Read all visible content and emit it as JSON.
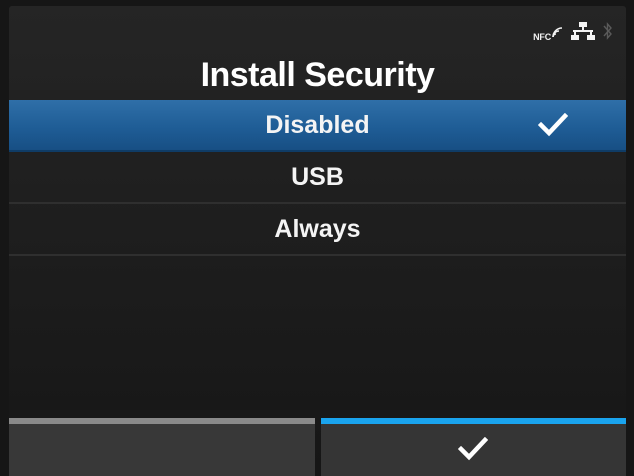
{
  "status_bar": {
    "nfc_label": "NFC",
    "icons": [
      "nfc-icon",
      "network-icon",
      "bluetooth-icon"
    ]
  },
  "screen": {
    "title": "Install Security"
  },
  "options": [
    {
      "label": "Disabled",
      "selected": true
    },
    {
      "label": "USB",
      "selected": false
    },
    {
      "label": "Always",
      "selected": false
    }
  ],
  "softkeys": {
    "left": {
      "icon": "",
      "highlight": "#8a8a8a"
    },
    "right": {
      "icon": "check-icon",
      "highlight": "#1aa4ee"
    }
  },
  "colors": {
    "selected_row": "#2366a0",
    "accent": "#1aa4ee",
    "background": "#1c1c1c"
  }
}
